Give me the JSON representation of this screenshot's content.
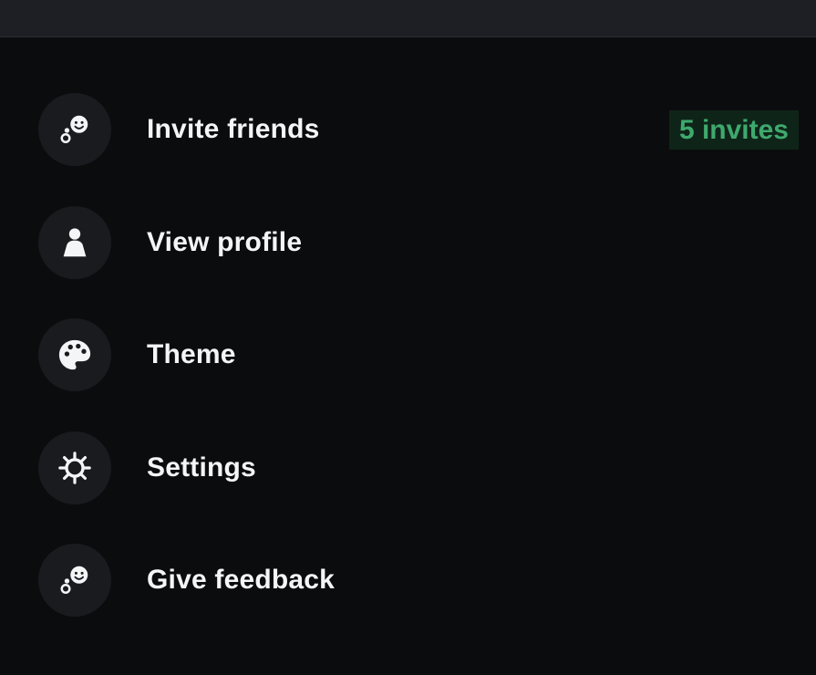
{
  "menu": {
    "items": [
      {
        "label": "Invite friends",
        "icon": "invite-friends-icon",
        "badge": "5 invites"
      },
      {
        "label": "View profile",
        "icon": "person-icon"
      },
      {
        "label": "Theme",
        "icon": "palette-icon"
      },
      {
        "label": "Settings",
        "icon": "gear-icon"
      },
      {
        "label": "Give feedback",
        "icon": "feedback-icon"
      }
    ]
  },
  "colors": {
    "background": "#0b0c0e",
    "top_bar": "#1d1f24",
    "icon_circle": "#1a1b1f",
    "badge_background": "#0f2419",
    "badge_text": "#3fa96d",
    "text": "#f4f5f7"
  }
}
